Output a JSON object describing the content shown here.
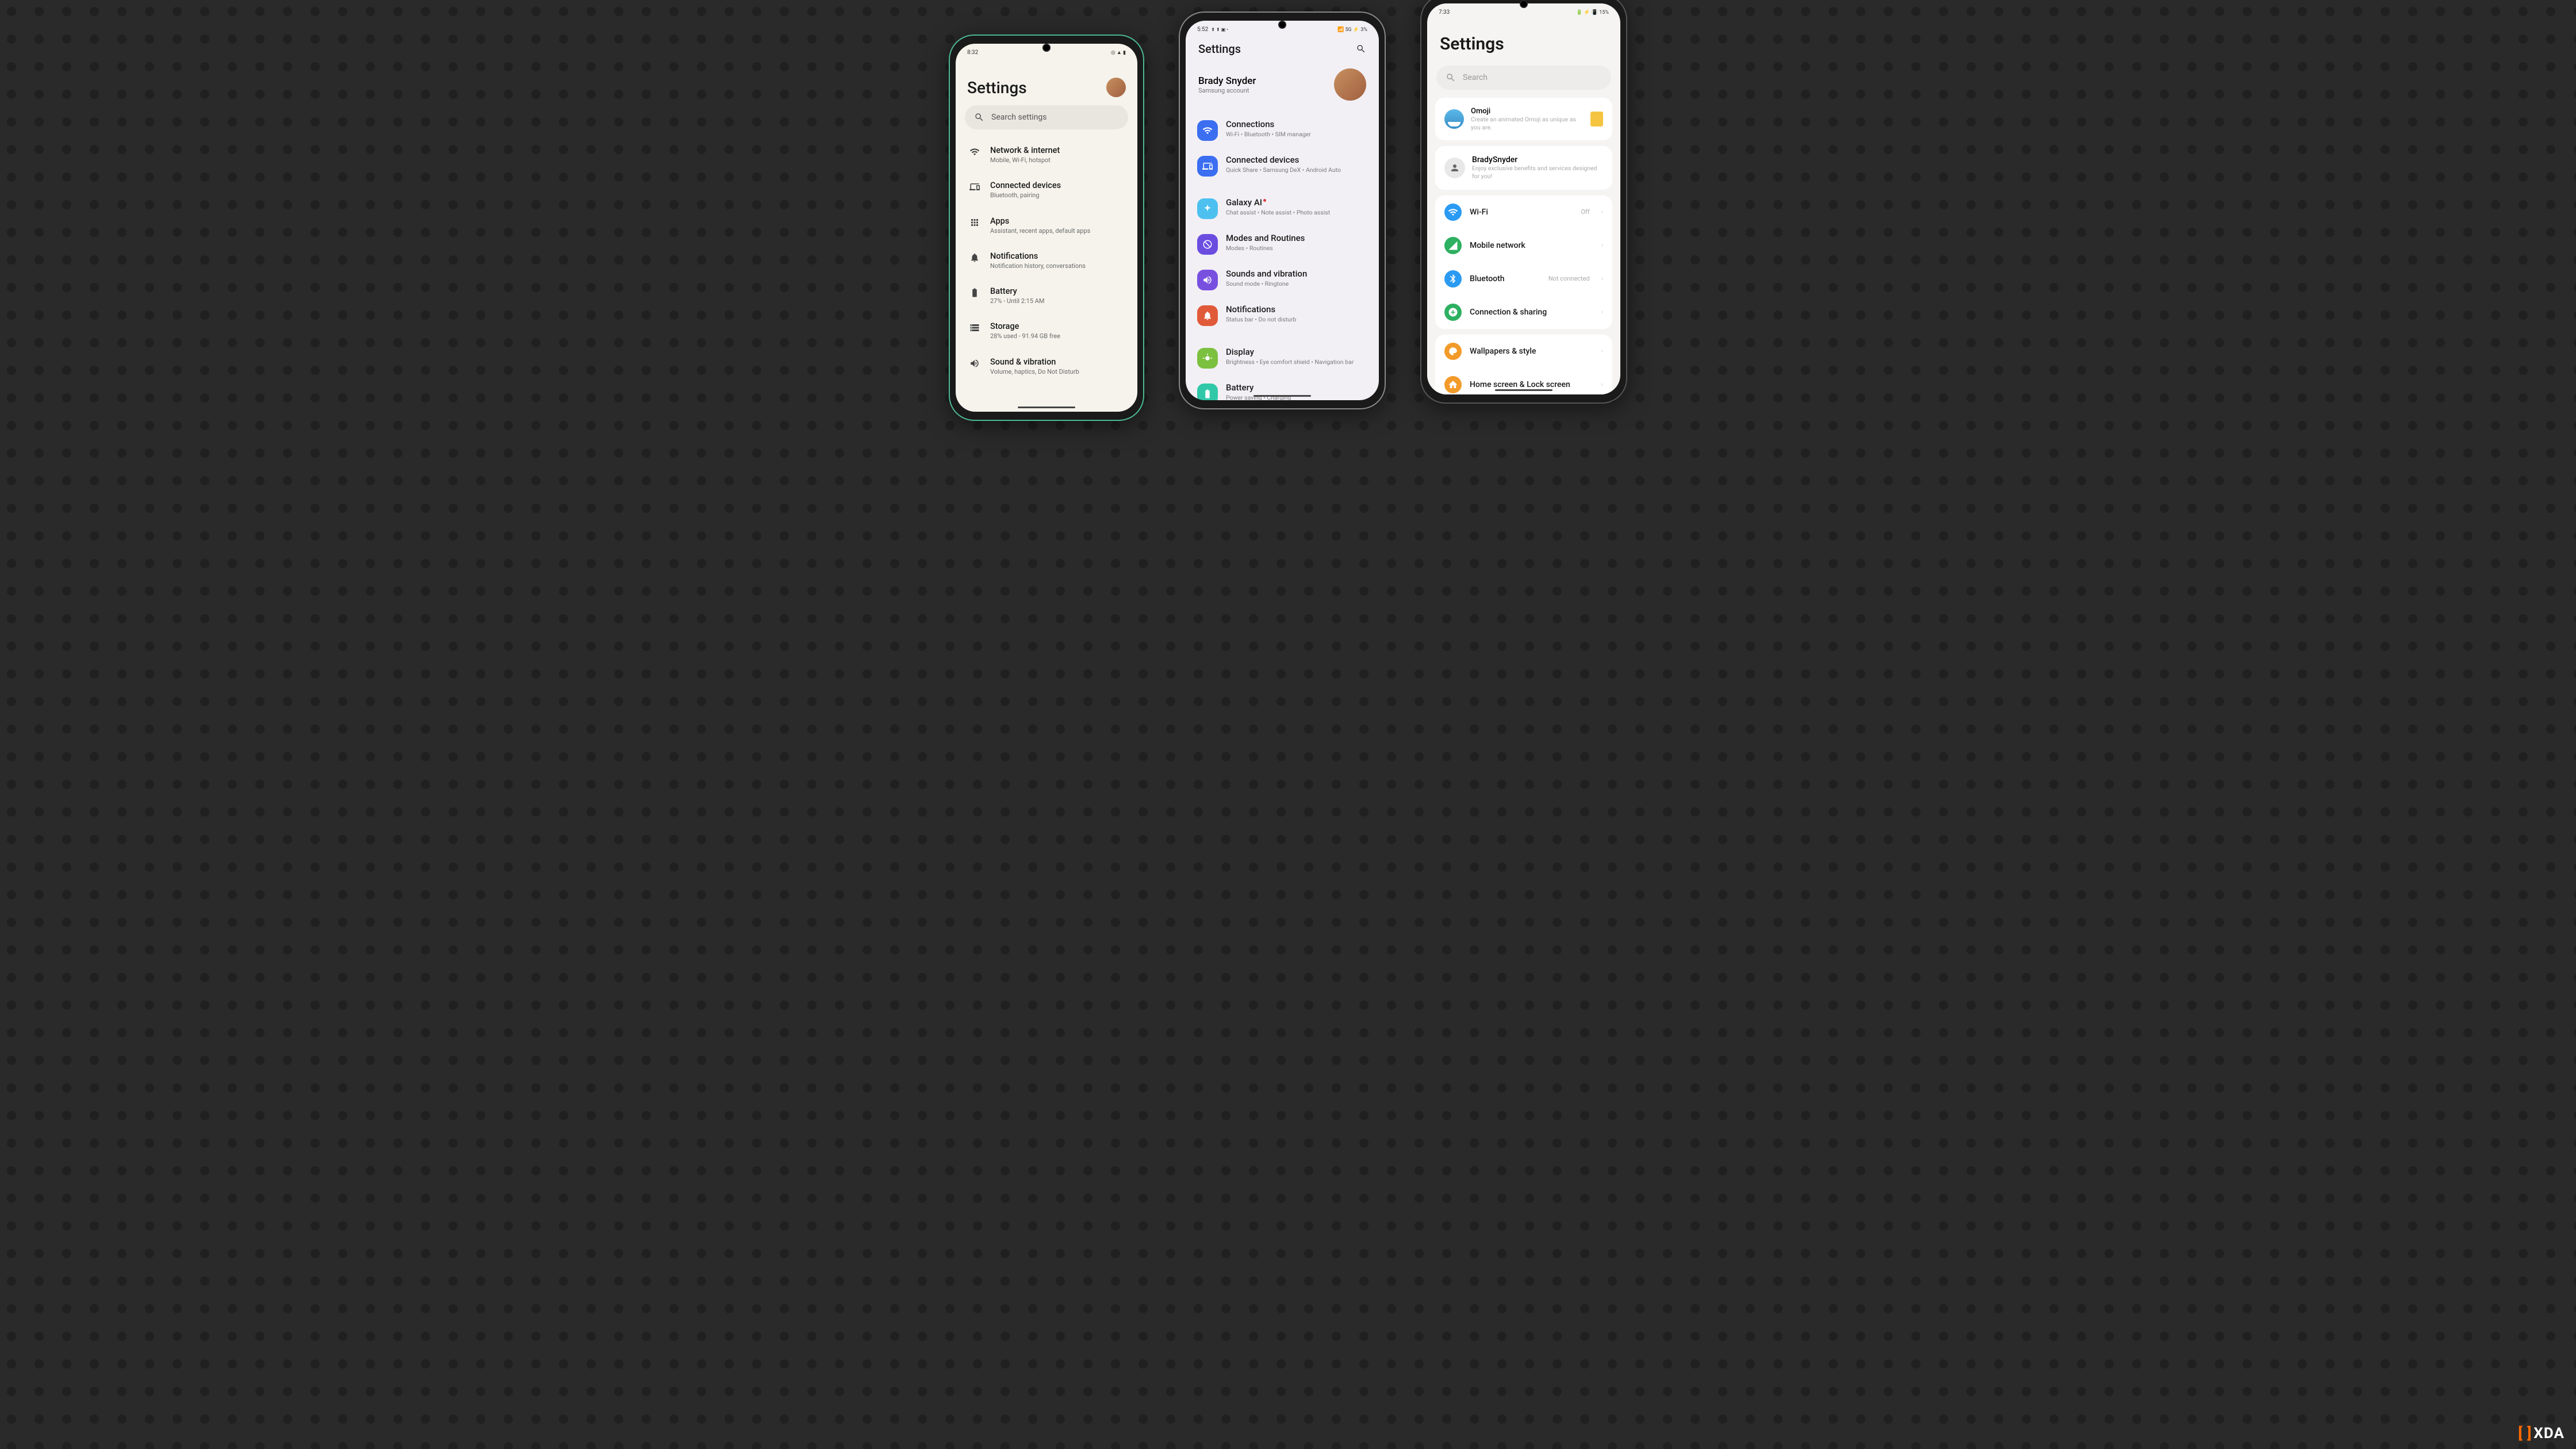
{
  "phone1": {
    "status": {
      "time": "8:32",
      "icons": "◎ ▲ ▮"
    },
    "title": "Settings",
    "search_placeholder": "Search settings",
    "items": [
      {
        "title": "Network & internet",
        "sub": "Mobile, Wi-Fi, hotspot",
        "icon": "wifi"
      },
      {
        "title": "Connected devices",
        "sub": "Bluetooth, pairing",
        "icon": "devices"
      },
      {
        "title": "Apps",
        "sub": "Assistant, recent apps, default apps",
        "icon": "apps"
      },
      {
        "title": "Notifications",
        "sub": "Notification history, conversations",
        "icon": "bell"
      },
      {
        "title": "Battery",
        "sub": "27% - Until 2:15 AM",
        "icon": "battery"
      },
      {
        "title": "Storage",
        "sub": "28% used - 91.94 GB free",
        "icon": "storage"
      },
      {
        "title": "Sound & vibration",
        "sub": "Volume, haptics, Do Not Disturb",
        "icon": "sound"
      }
    ]
  },
  "phone2": {
    "status": {
      "time": "5:52",
      "left_icons": "⬆ ⬆ ▣ •",
      "right": "📶 5G ⚡ 3%"
    },
    "title": "Settings",
    "account_name": "Brady Snyder",
    "account_sub": "Samsung account",
    "items": [
      {
        "title": "Connections",
        "sub": "Wi-Fi • Bluetooth • SIM manager",
        "color": "#3b6ef0",
        "icon": "wifi"
      },
      {
        "title": "Connected devices",
        "sub": "Quick Share • Samsung DeX • Android Auto",
        "color": "#3b6ef0",
        "icon": "devices"
      },
      {
        "title": "Galaxy AI",
        "sub": "Chat assist • Note assist • Photo assist",
        "color": "#4dc0f0",
        "icon": "sparkle",
        "dot": true
      },
      {
        "title": "Modes and Routines",
        "sub": "Modes • Routines",
        "color": "#6b4de0",
        "icon": "modes"
      },
      {
        "title": "Sounds and vibration",
        "sub": "Sound mode • Ringtone",
        "color": "#7850e0",
        "icon": "sound"
      },
      {
        "title": "Notifications",
        "sub": "Status bar • Do not disturb",
        "color": "#e05a3a",
        "icon": "bell"
      },
      {
        "title": "Display",
        "sub": "Brightness • Eye comfort shield • Navigation bar",
        "color": "#7cc040",
        "icon": "display"
      },
      {
        "title": "Battery",
        "sub": "Power saving • Charging",
        "color": "#30c8a8",
        "icon": "battery"
      }
    ]
  },
  "phone3": {
    "status": {
      "time": "7:33",
      "right": "🔋 ⚡ 📳 15%"
    },
    "title": "Settings",
    "search_placeholder": "Search",
    "promo": {
      "title": "Omoji",
      "sub": "Create an animated Omoji as unique as you are."
    },
    "account": {
      "name": "BradySnyder",
      "sub": "Enjoy exclusive benefits and services designed for you!"
    },
    "group1": [
      {
        "title": "Wi-Fi",
        "value": "Off",
        "color": "#2a9af2",
        "icon": "wifi"
      },
      {
        "title": "Mobile network",
        "value": "",
        "color": "#2db060",
        "icon": "signal"
      },
      {
        "title": "Bluetooth",
        "value": "Not connected",
        "color": "#2a9af2",
        "icon": "bluetooth"
      },
      {
        "title": "Connection & sharing",
        "value": "",
        "color": "#2db060",
        "icon": "share"
      }
    ],
    "group2": [
      {
        "title": "Wallpapers & style",
        "value": "",
        "color": "#f29a2a",
        "icon": "palette"
      },
      {
        "title": "Home screen & Lock screen",
        "value": "",
        "color": "#f29a2a",
        "icon": "home"
      }
    ]
  },
  "watermark": "XDA"
}
